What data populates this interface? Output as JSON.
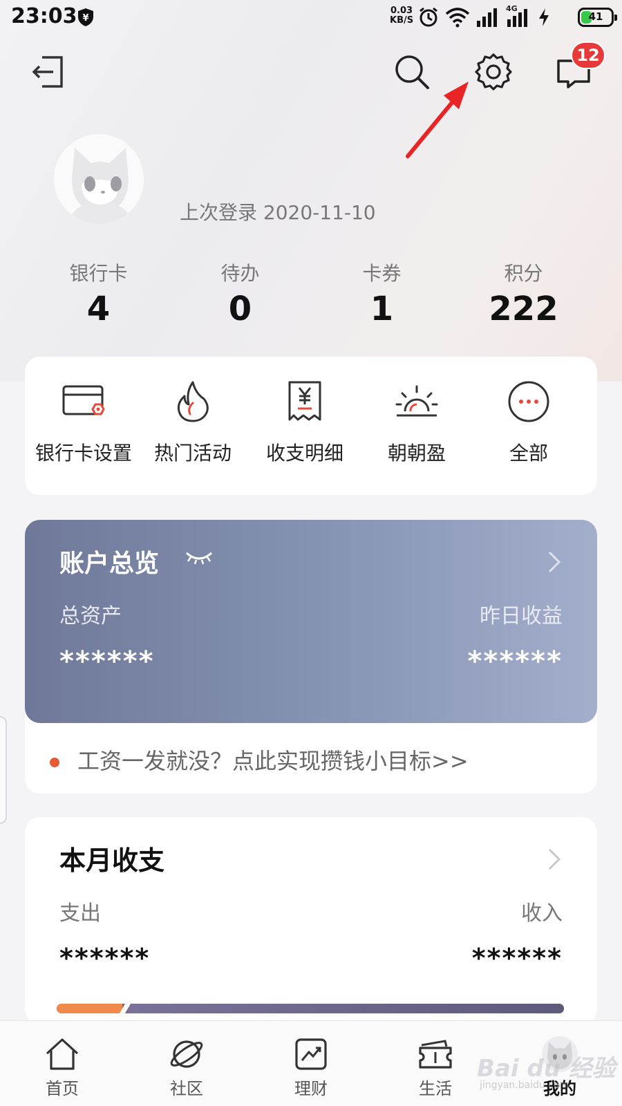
{
  "status_bar": {
    "time": "23:03",
    "net_speed_value": "0.03",
    "net_speed_unit": "KB/S",
    "network_type": "4G",
    "battery": "41",
    "battery_level": 0.41
  },
  "toolbar": {
    "message_badge": "12",
    "icons": [
      "logout-icon",
      "search-icon",
      "gear-icon",
      "message-icon"
    ]
  },
  "profile": {
    "last_login": "上次登录 2020-11-10"
  },
  "stats": [
    {
      "label": "银行卡",
      "value": "4"
    },
    {
      "label": "待办",
      "value": "0"
    },
    {
      "label": "卡券",
      "value": "1"
    },
    {
      "label": "积分",
      "value": "222"
    }
  ],
  "quick_menu": [
    {
      "label": "银行卡设置",
      "icon": "bank-card-settings-icon"
    },
    {
      "label": "热门活动",
      "icon": "flame-icon"
    },
    {
      "label": "收支明细",
      "icon": "receipt-icon"
    },
    {
      "label": "朝朝盈",
      "icon": "sunrise-icon"
    },
    {
      "label": "全部",
      "icon": "more-icon"
    }
  ],
  "account": {
    "title": "账户总览",
    "total_assets_label": "总资产",
    "yesterday_income_label": "昨日收益",
    "total_assets_value": "******",
    "yesterday_income_value": "******",
    "promo": "工资一发就没？点此实现攒钱小目标>>"
  },
  "monthly": {
    "title": "本月收支",
    "expense_label": "支出",
    "income_label": "收入",
    "expense_value": "******",
    "income_value": "******",
    "expense_share": 0.13
  },
  "bottom_nav": [
    {
      "label": "首页",
      "icon": "home-icon"
    },
    {
      "label": "社区",
      "icon": "planet-icon"
    },
    {
      "label": "理财",
      "icon": "chart-icon"
    },
    {
      "label": "生活",
      "icon": "ticket-icon"
    },
    {
      "label": "我的",
      "icon": "avatar-icon"
    }
  ],
  "watermark": {
    "brand": "Bai du 经验",
    "url": "jingyan.baidu.com"
  },
  "colors": {
    "badge": "#e63a3a",
    "annotation_arrow": "#e82424",
    "account_card": "#8a97b6",
    "accent_red": "#e65a34"
  }
}
